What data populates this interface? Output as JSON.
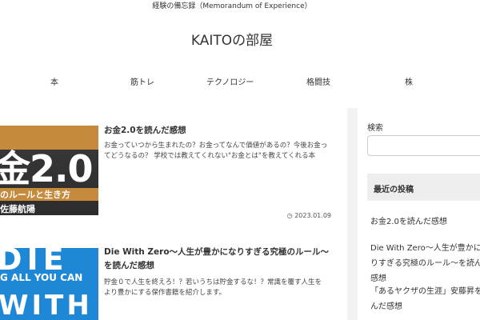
{
  "header": {
    "tagline": "経験の備忘録（Memorandum of Experience）",
    "site_title": "KAITOの部屋"
  },
  "nav": [
    {
      "label": "本"
    },
    {
      "label": "筋トレ"
    },
    {
      "label": "テクノロジー"
    },
    {
      "label": "格闘技"
    },
    {
      "label": "株"
    }
  ],
  "articles": [
    {
      "title": "お金2.0を読んだ感想",
      "excerpt": "お金っていつから生まれたの？お金ってなんで価値があるの？今後お金ってどうなるの？ 学校では教えてくれない\"お金とは\"を教えてくれる本",
      "date": "2023.01.09",
      "thumb_big": "金2.0",
      "thumb_mid": "のルールと生き方",
      "thumb_bot": "佐藤航陽"
    },
    {
      "title": "Die With Zero～人生が豊かになりすぎる究極のルール～を読んだ感想",
      "excerpt": "貯金０で人生を終えろ！？若いうちは貯金するな！？常識を覆す人生をより豊かにする保作書籍を紹介します。",
      "date": "",
      "thumb_top": "DIE",
      "thumb_mid": "G ALL YOU CAN",
      "thumb_bot": "WITH"
    }
  ],
  "sidebar": {
    "search_label": "検索",
    "search_placeholder": "",
    "recent_heading": "最近の投稿",
    "recent_posts": [
      "お金2.0を読んだ感想",
      "Die With Zero～人生が豊かになりすぎる究極のルール～を読んだ感想",
      "「あるヤクザの生涯」安藤昇を読んだ感想"
    ]
  },
  "colors": {
    "accent_blue": "#1e88d6",
    "book_gold": "#c58a3c"
  },
  "icons": {
    "date": "clock-icon"
  }
}
